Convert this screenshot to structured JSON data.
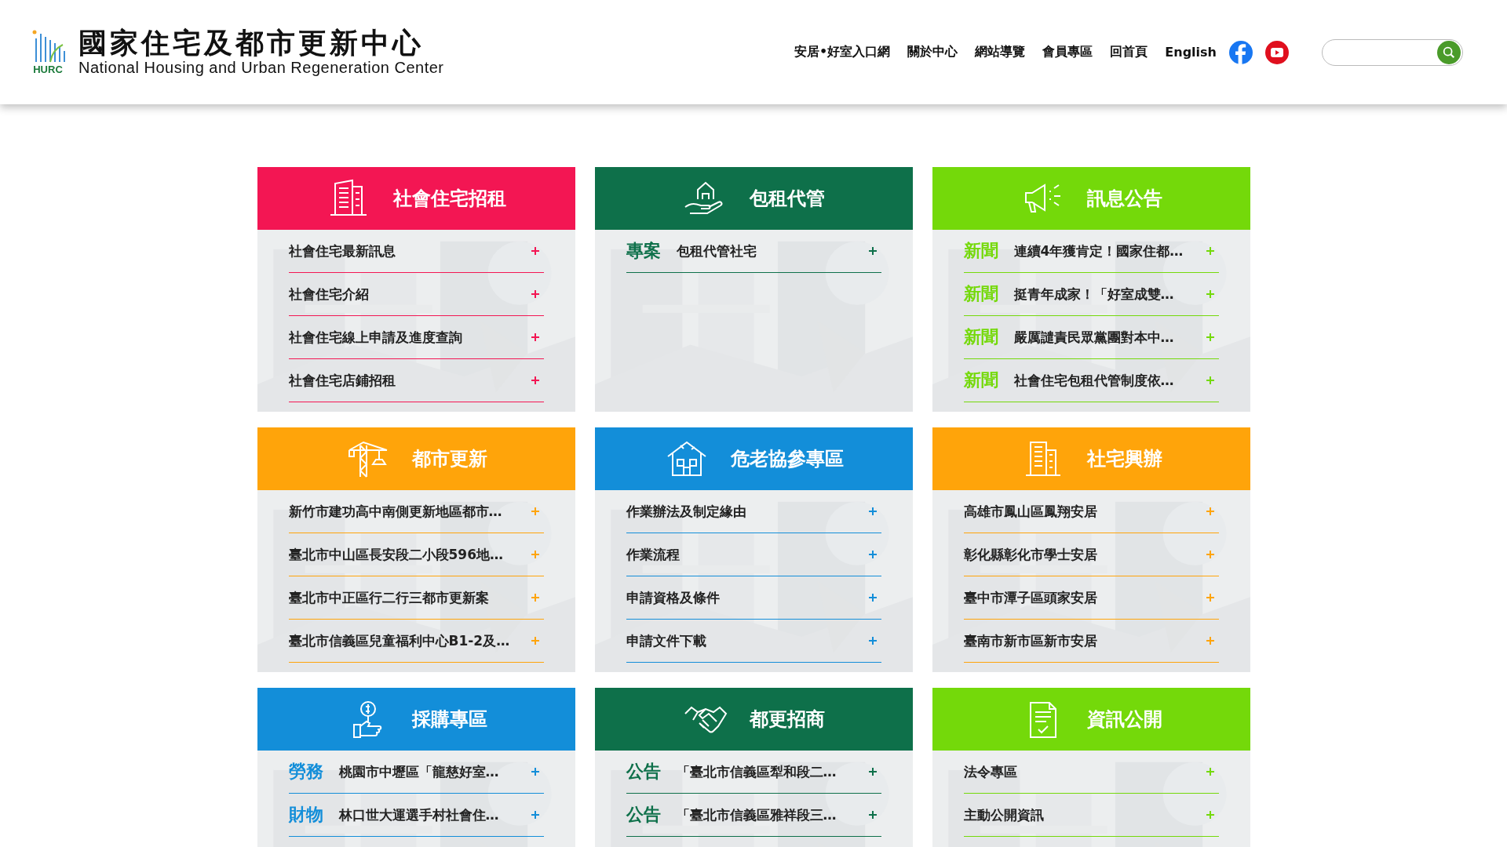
{
  "header": {
    "logo_text": "HURC",
    "title_zh": "國家住宅及都市更新中心",
    "title_en": "National Housing and Urban Regeneration Center",
    "nav": [
      "安居•好室入口網",
      "關於中心",
      "網站導覽",
      "會員專區",
      "回首頁",
      "English"
    ]
  },
  "cards": [
    {
      "title": "社會住宅招租",
      "color": "#f31653",
      "items": [
        {
          "text": "社會住宅最新訊息"
        },
        {
          "text": "社會住宅介紹"
        },
        {
          "text": "社會住宅線上申請及進度查詢"
        },
        {
          "text": "社會住宅店鋪招租"
        }
      ]
    },
    {
      "title": "包租代管",
      "color": "#0e704a",
      "items": [
        {
          "tag": "專案",
          "text": "包租代管社宅"
        }
      ]
    },
    {
      "title": "訊息公告",
      "color": "#74d90a",
      "items": [
        {
          "tag": "新聞",
          "text": "連續4年獲肯定！國家住都…"
        },
        {
          "tag": "新聞",
          "text": "挺青年成家！「好室成雙…"
        },
        {
          "tag": "新聞",
          "text": "嚴厲譴責民眾黨團對本中…"
        },
        {
          "tag": "新聞",
          "text": "社會住宅包租代管制度依…"
        }
      ]
    },
    {
      "title": "都市更新",
      "color": "#ffa40a",
      "items": [
        {
          "text": "新竹市建功高中南側更新地區都市…"
        },
        {
          "text": "臺北市中山區長安段二小段596地…"
        },
        {
          "text": "臺北市中正區行二行三都市更新案"
        },
        {
          "text": "臺北市信義區兒童福利中心B1-2及…"
        }
      ]
    },
    {
      "title": "危老協參專區",
      "color": "#138ed9",
      "items": [
        {
          "text": "作業辦法及制定緣由"
        },
        {
          "text": "作業流程"
        },
        {
          "text": "申請資格及條件"
        },
        {
          "text": "申請文件下載"
        }
      ]
    },
    {
      "title": "社宅興辦",
      "color": "#ffa40a",
      "items": [
        {
          "text": "高雄市鳳山區鳳翔安居"
        },
        {
          "text": "彰化縣彰化市學士安居"
        },
        {
          "text": "臺中市潭子區頭家安居"
        },
        {
          "text": "臺南市新市區新市安居"
        }
      ]
    },
    {
      "title": "採購專區",
      "color": "#138ed9",
      "items": [
        {
          "tag": "勞務",
          "text": "桃園市中壢區「龍慈好室…"
        },
        {
          "tag": "財物",
          "text": "林口世大運選手村社會住…"
        }
      ]
    },
    {
      "title": "都更招商",
      "color": "#0e704a",
      "items": [
        {
          "tag": "公告",
          "text": "「臺北市信義區犁和段二…"
        },
        {
          "tag": "公告",
          "text": "「臺北市信義區雅祥段三…"
        }
      ]
    },
    {
      "title": "資訊公開",
      "color": "#74d90a",
      "items": [
        {
          "text": "法令專區"
        },
        {
          "text": "主動公開資訊"
        }
      ]
    }
  ]
}
